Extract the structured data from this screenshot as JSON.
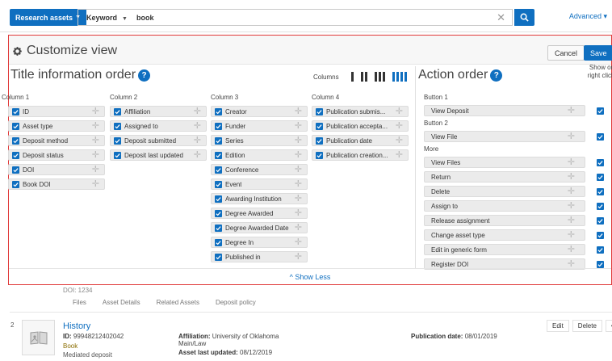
{
  "search": {
    "scope_label": "Research assets",
    "field_label": "Keyword",
    "query": "book",
    "advanced_label": "Advanced"
  },
  "customize": {
    "title": "Customize view",
    "cancel_label": "Cancel",
    "save_label": "Save",
    "title_info_heading": "Title information order",
    "columns_label": "Columns",
    "columns_selected": 4,
    "action_heading": "Action order",
    "show_on_right_click": "Show on right click",
    "show_less_label": "Show Less",
    "columns": [
      {
        "label": "Column 1",
        "items": [
          "ID",
          "Asset type",
          "Deposit method",
          "Deposit status",
          "DOI",
          "Book DOI"
        ]
      },
      {
        "label": "Column 2",
        "items": [
          "Affiliation",
          "Assigned to",
          "Deposit submitted",
          "Deposit last updated"
        ]
      },
      {
        "label": "Column 3",
        "items": [
          "Creator",
          "Funder",
          "Series",
          "Edition",
          "Conference",
          "Event",
          "Awarding Institution",
          "Degree Awarded",
          "Degree Awarded Date",
          "Degree In",
          "Published in"
        ]
      },
      {
        "label": "Column 4",
        "items": [
          "Publication submis...",
          "Publication accepta...",
          "Publication date",
          "Publication creation..."
        ]
      }
    ],
    "actions": {
      "button1_label": "Button 1",
      "button1": "View Deposit",
      "button2_label": "Button 2",
      "button2": "View File",
      "more_label": "More",
      "more": [
        "View Files",
        "Return",
        "Delete",
        "Assign to",
        "Release assignment",
        "Change asset type",
        "Edit in generic form",
        "Register DOI"
      ]
    }
  },
  "results": {
    "prev_doi": "DOI: 1234",
    "prev_tabs": [
      "Files",
      "Asset Details",
      "Related Assets",
      "Deposit policy"
    ],
    "item": {
      "number": "2",
      "title": "History",
      "id_label": "ID:",
      "id": "99948212402042",
      "type": "Book",
      "status": "Mediated deposit",
      "affiliation_label": "Affiliation:",
      "affiliation": "University of Oklahoma Main/Law",
      "updated_label": "Asset last updated:",
      "updated": "08/12/2019",
      "pub_label": "Publication date:",
      "pub_date": "08/01/2019",
      "actions": [
        "Edit",
        "Delete",
        "•••"
      ]
    }
  },
  "colors": {
    "accent": "#0f6fc0",
    "highlight_border": "#e03a3a"
  }
}
